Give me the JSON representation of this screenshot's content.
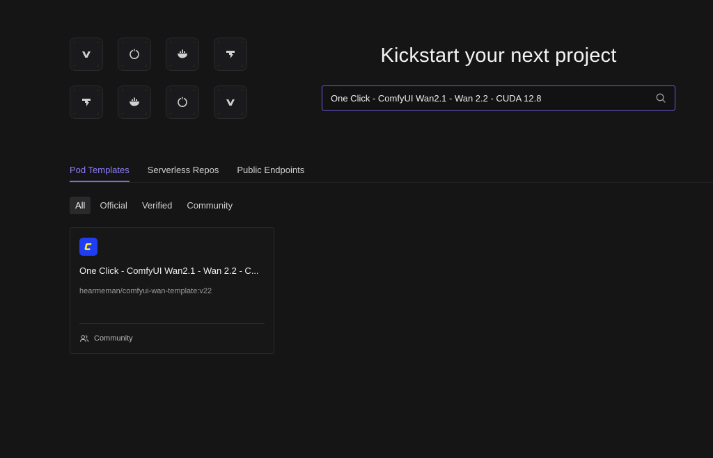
{
  "hero": {
    "title": "Kickstart your next project"
  },
  "search": {
    "value": "One Click - ComfyUI Wan2.1 - Wan 2.2 - CUDA 12.8",
    "accent_color": "#6b5ce0"
  },
  "icon_grid": {
    "tiles": [
      {
        "icon": "v-logo-icon"
      },
      {
        "icon": "ring-icon"
      },
      {
        "icon": "docker-whale-icon"
      },
      {
        "icon": "flame-arrow-icon"
      },
      {
        "icon": "flame-arrow-icon"
      },
      {
        "icon": "docker-whale-icon"
      },
      {
        "icon": "ring-icon"
      },
      {
        "icon": "v-logo-icon"
      }
    ]
  },
  "tabs": [
    {
      "label": "Pod Templates",
      "active": true
    },
    {
      "label": "Serverless Repos",
      "active": false
    },
    {
      "label": "Public Endpoints",
      "active": false
    }
  ],
  "filters": [
    {
      "label": "All",
      "active": true
    },
    {
      "label": "Official",
      "active": false
    },
    {
      "label": "Verified",
      "active": false
    },
    {
      "label": "Community",
      "active": false
    }
  ],
  "results": [
    {
      "icon": "comfyui-logo-icon",
      "title": "One Click - ComfyUI Wan2.1 - Wan 2.2 - C...",
      "image": "hearmeman/comfyui-wan-template:v22",
      "category": "Community",
      "category_icon": "users-icon"
    }
  ],
  "colors": {
    "background": "#151516",
    "accent": "#8b7cf6",
    "comfy_logo_bg": "#1f3df5",
    "comfy_logo_fg": "#f5e547"
  }
}
